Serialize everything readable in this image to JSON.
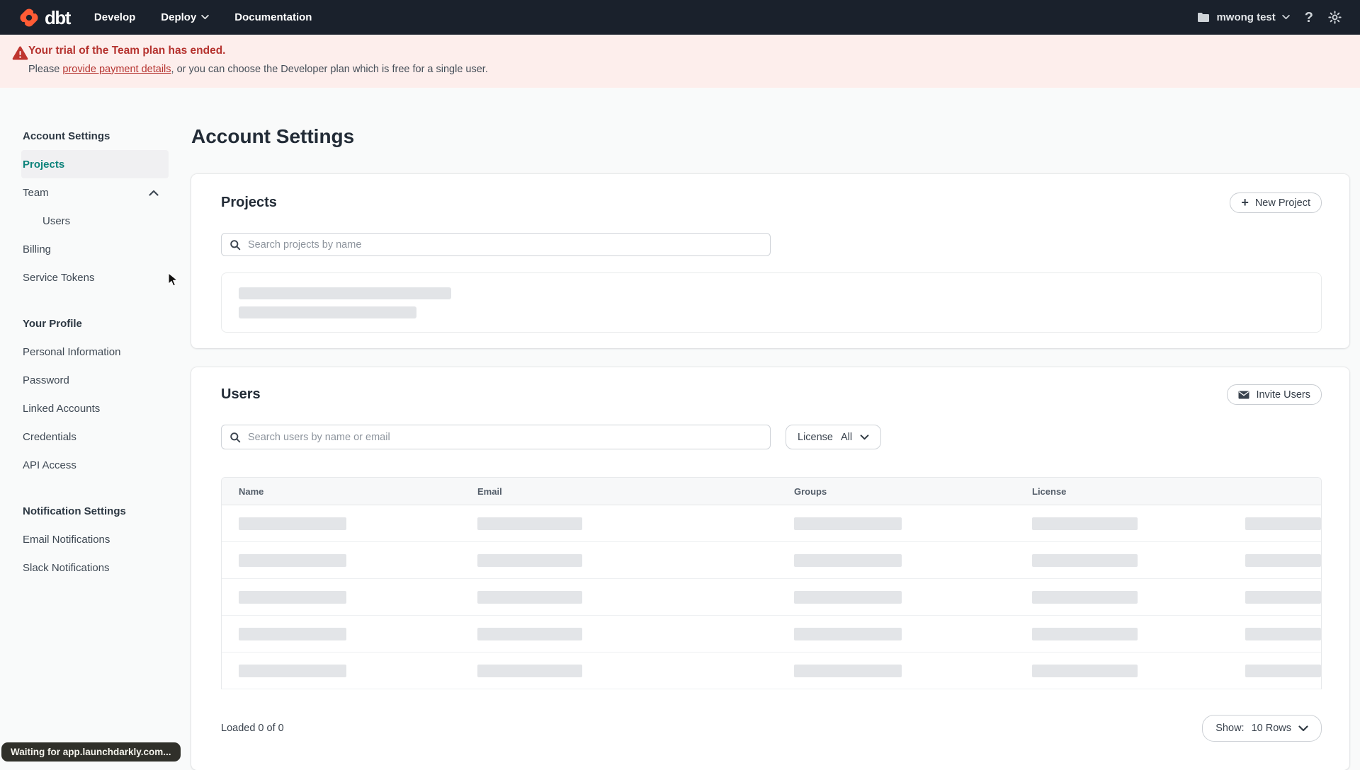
{
  "topnav": {
    "logo_text": "dbt",
    "nav": [
      {
        "label": "Develop"
      },
      {
        "label": "Deploy"
      },
      {
        "label": "Documentation"
      }
    ],
    "account_name": "mwong test"
  },
  "banner": {
    "title": "Your trial of the Team plan has ended.",
    "message_prefix": "Please ",
    "link_text": "provide payment details",
    "message_suffix": ", or you can choose the Developer plan which is free for a single user."
  },
  "sidebar": {
    "sections": [
      {
        "title": "Account Settings",
        "items": [
          {
            "label": "Projects"
          },
          {
            "label": "Team"
          },
          {
            "label": "Users"
          },
          {
            "label": "Billing"
          },
          {
            "label": "Service Tokens"
          }
        ]
      },
      {
        "title": "Your Profile",
        "items": [
          {
            "label": "Personal Information"
          },
          {
            "label": "Password"
          },
          {
            "label": "Linked Accounts"
          },
          {
            "label": "Credentials"
          },
          {
            "label": "API Access"
          }
        ]
      },
      {
        "title": "Notification Settings",
        "items": [
          {
            "label": "Email Notifications"
          },
          {
            "label": "Slack Notifications"
          }
        ]
      }
    ]
  },
  "page": {
    "title": "Account Settings"
  },
  "projects_card": {
    "title": "Projects",
    "new_project_button": "New Project",
    "search_placeholder": "Search projects by name"
  },
  "users_card": {
    "title": "Users",
    "invite_button": "Invite Users",
    "search_placeholder": "Search users by name or email",
    "license_label": "License",
    "license_value": "All",
    "columns": [
      "Name",
      "Email",
      "Groups",
      "License"
    ],
    "loaded_text": "Loaded 0 of 0",
    "show_label": "Show:",
    "show_value": "10 Rows"
  },
  "status_pill": {
    "text": "Waiting for app.launchdarkly.com..."
  },
  "colors": {
    "brand_orange": "#ff5c35",
    "accent_teal": "#0d837b",
    "alert_red": "#b5332f",
    "nav_bg": "#1a212c",
    "banner_bg": "#fdeeec"
  }
}
